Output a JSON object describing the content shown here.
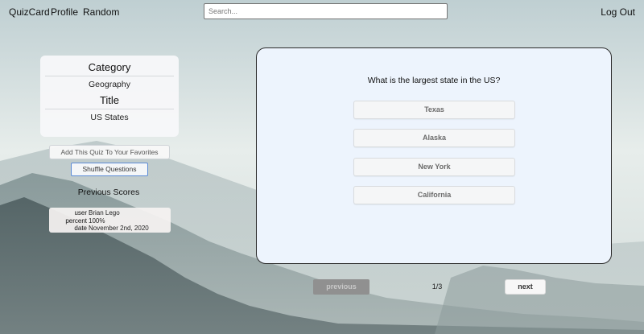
{
  "nav": {
    "brand": "QuizCard",
    "profile": "Profile",
    "random": "Random",
    "logout": "Log Out",
    "search_placeholder": "Search..."
  },
  "info": {
    "category_heading": "Category",
    "category_value": "Geography",
    "title_heading": "Title",
    "title_value": "US States"
  },
  "actions": {
    "favorite_label": "Add This Quiz To Your Favorites",
    "shuffle_label": "Shuffle Questions"
  },
  "scores": {
    "heading": "Previous Scores",
    "entries": [
      {
        "user_key": "user",
        "user": "Brian Lego",
        "percent_key": "percent",
        "percent": "100%",
        "date_key": "date",
        "date": "November 2nd, 2020"
      }
    ]
  },
  "quiz": {
    "question": "What is the largest state in the US?",
    "answers": [
      "Texas",
      "Alaska",
      "New York",
      "California"
    ]
  },
  "pager": {
    "previous_label": "previous",
    "indicator": "1/3",
    "next_label": "next"
  }
}
